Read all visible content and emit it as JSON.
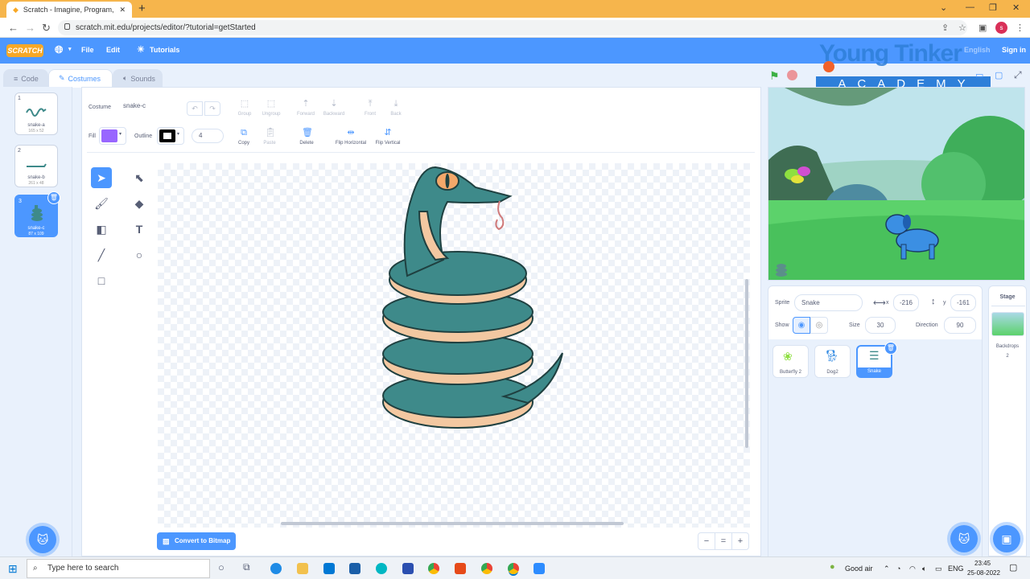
{
  "browser": {
    "tab_title": "Scratch - Imagine, Program, Sha",
    "url": "scratch.mit.edu/projects/editor/?tutorial=getStarted",
    "profile_initial": "s"
  },
  "menu": {
    "logo": "SCRATCH",
    "file": "File",
    "edit": "Edit",
    "tutorials": "Tutorials",
    "language_hint": "English",
    "sign_in": "Sign in"
  },
  "watermark": {
    "title": "Young Tinker",
    "subtitle": "ACADEMY"
  },
  "tabs": [
    {
      "label": "Code",
      "icon": "code-icon"
    },
    {
      "label": "Costumes",
      "icon": "brush-icon"
    },
    {
      "label": "Sounds",
      "icon": "speaker-icon"
    }
  ],
  "costumes": [
    {
      "number": "1",
      "name": "snake-a",
      "size": "165 x 52"
    },
    {
      "number": "2",
      "name": "snake-b",
      "size": "261 x 48"
    },
    {
      "number": "3",
      "name": "snake-c",
      "size": "87 x 109"
    }
  ],
  "editor": {
    "costume_label": "Costume",
    "costume_name": "snake-c",
    "fill_label": "Fill",
    "outline_label": "Outline",
    "outline_width": "4",
    "fill_color": "#9966ff",
    "outline_color": "#000000",
    "buttons": {
      "group": "Group",
      "ungroup": "Ungroup",
      "forward": "Forward",
      "backward": "Backward",
      "front": "Front",
      "back": "Back",
      "copy": "Copy",
      "paste": "Paste",
      "delete": "Delete",
      "flip_h": "Flip Horizontal",
      "flip_v": "Flip Vertical"
    },
    "convert": "Convert to Bitmap",
    "zoom_out": "−",
    "zoom_reset": "=",
    "zoom_in": "+"
  },
  "sprite_info": {
    "sprite_label": "Sprite",
    "sprite_name": "Snake",
    "x_label": "x",
    "x_value": "-216",
    "y_label": "y",
    "y_value": "-161",
    "show_label": "Show",
    "size_label": "Size",
    "size_value": "30",
    "direction_label": "Direction",
    "direction_value": "90"
  },
  "sprites": [
    {
      "name": "Butterfly 2"
    },
    {
      "name": "Dog2"
    },
    {
      "name": "Snake"
    }
  ],
  "stage_pane": {
    "title": "Stage",
    "backdrops_label": "Backdrops",
    "backdrops_count": "2"
  },
  "taskbar": {
    "search_placeholder": "Type here to search",
    "weather": "Good air",
    "lang": "ENG",
    "time": "23:45",
    "date": "25-08-2022"
  },
  "colors": {
    "scratch_blue": "#4c97ff",
    "chrome_tab_bar": "#f6b54c",
    "snake_body": "#3e8a8a",
    "snake_belly": "#f3c8a1"
  }
}
